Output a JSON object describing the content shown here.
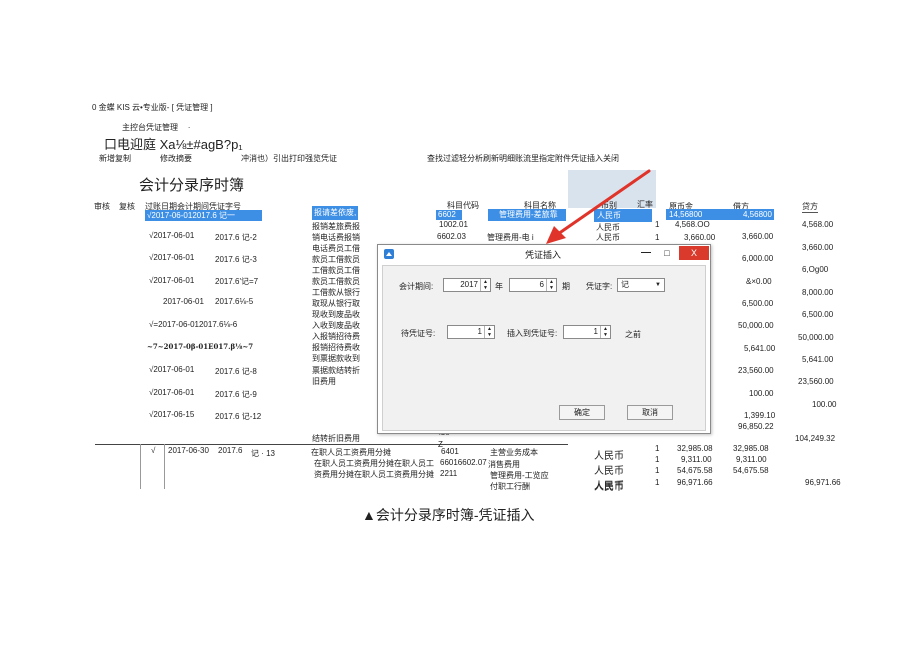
{
  "window": {
    "title": "0 金蝶 KIS 云•专业版- [ 凭证管理 ]"
  },
  "nav": {
    "breadcrumb": "主控台凭证管理",
    "dot": "."
  },
  "toolbar1": {
    "text": "口电迎庭 Xa⅛±#agB?p₁"
  },
  "toolbar2": {
    "add_copy": "新增复制",
    "edit_summary": "修改摘要",
    "cancel_print_preview": "冲消也）引出打印强览凭证",
    "right_tools": "查找过滤轻分析刷新明细账流里指定附件凭证插入关闭"
  },
  "page_title": "会计分录序时簿",
  "table_header": {
    "audit": "审核",
    "review": "复核",
    "main": "过账日期会计期间凭证字号",
    "account_code": "科目代码",
    "account_name": "科目名称",
    "currency": "币别",
    "rate": "汇率",
    "orig_amount": "原币金",
    "debit": "借方",
    "credit": "贷方"
  },
  "rows": [
    {
      "date_period_voucher": "√2017-06-012017.6 记一",
      "summary": "报请差依废,",
      "code": "6602",
      "name": "管理费用-差旅靠",
      "currency": "人民币",
      "orig": "14,56800",
      "debit": "4,56800",
      "credit": ""
    },
    {
      "date": "√2017-06-01",
      "voucher": "2017.6 记-2",
      "summary": "报销差旅费报",
      "code": "1002.01",
      "name": "",
      "currency": "人民币",
      "rate": "1",
      "orig": "4,568.OO",
      "debit": "",
      "credit": "4,568.00"
    },
    {
      "summary": "销电话费报销",
      "code": "6602.03",
      "name": "管理费用-电 i",
      "currency": "人民币",
      "rate": "1",
      "orig": "3,660.00",
      "debit": "3,660.00",
      "credit": ""
    },
    {
      "date": "√2017-06-01",
      "voucher": "2017.6 记-3",
      "summary": "电话费员工借",
      "credit": "3,660.00"
    },
    {
      "summary": "款员工借款员",
      "debit": "6,000.00"
    },
    {
      "date": "√2017-06-01",
      "voucher": "2017.6'记=7",
      "summary": "工借款员工借",
      "credit": "6,Og00"
    },
    {
      "summary": "款员工借款员",
      "debit": "&×0.00"
    },
    {
      "date": "2017-06-01",
      "voucher": "2017.6⅛-5",
      "summary": "工借款从银行",
      "credit": "8,000.00"
    },
    {
      "summary": "取现从银行取",
      "debit": "6,500.00"
    },
    {
      "date_period_voucher": "√=2017-06-012017.6⅛-6",
      "summary": "现收到废品收",
      "credit": "6,500.00"
    },
    {
      "summary": "入收到废品收",
      "debit": "50,000.00"
    },
    {
      "date_period_voucher": "~7~2017-0β-01E017.β⅛~7",
      "summary": "入报销招待费",
      "credit": "50,000.00"
    },
    {
      "summary": "报销招待费收",
      "debit": "5,641.00"
    },
    {
      "date": "√2017-06-01",
      "voucher": "2017.6 记-8",
      "summary": "到票据款收到",
      "credit": "5,641.00"
    },
    {
      "summary": "票据款结转折",
      "debit": "23,560.00"
    },
    {
      "date": "√2017-06-01",
      "voucher": "2017.6 记-9",
      "summary": "旧费用",
      "credit": "23,560.00"
    },
    {
      "debit": "100.00"
    },
    {
      "date": "√2017-06-15",
      "voucher": "2017.6 记-12",
      "credit": "100.00"
    },
    {
      "debit": "1,399.10"
    },
    {
      "debit": "96,850.22"
    },
    {
      "summary": "结转折旧费用",
      "code": "IOU",
      "credit": "104,249.32"
    }
  ],
  "bottom_rows": {
    "mark": "√",
    "date": "2017-06-30",
    "period": "2017.6",
    "voucher": "记 · 13",
    "code_z": "Z",
    "summary_lines": [
      "在职人员工资费用分摊",
      "在职人员工资费用分摊在职人员工",
      "资费用分摊在职人员工资费用分摊"
    ],
    "codes": [
      "6401",
      "66016602.07",
      "2211"
    ],
    "names": [
      "主营业务成本",
      "消售费用",
      "管理费用-工览应",
      "付职工行酬"
    ],
    "currencies": [
      "人民币",
      "人民币",
      "人民币",
      "人民币"
    ],
    "rates": [
      "1",
      "1",
      "1",
      "1"
    ],
    "origs": [
      "32,985.08",
      "9,311.00",
      "54,675.58",
      "96,971.66"
    ],
    "debits": [
      "32,985.08",
      "9,311.00",
      "54,675.58",
      ""
    ],
    "credit_last": "96,971.66"
  },
  "dialog": {
    "title": "凭证插入",
    "period_label": "会计期间:",
    "year_value": "2017",
    "year_label": "年",
    "month_value": "6",
    "month_label": "期",
    "voucher_word_label": "凭证字:",
    "voucher_word_value": "记",
    "voucher_no_label": "待凭证号:",
    "voucher_no_value": "1",
    "insert_to_label": "插入到凭证号:",
    "insert_to_value": "1",
    "before_label": "之前",
    "ok_label": "确定",
    "cancel_label": "取消",
    "min_label": "—",
    "max_label": "□",
    "close_label": "X"
  },
  "caption": "▲会计分录序时簿-凭证插入",
  "colors": {
    "selection": "#3d8fe6",
    "close_button": "#d93a2b",
    "arrow": "#e0342a"
  }
}
